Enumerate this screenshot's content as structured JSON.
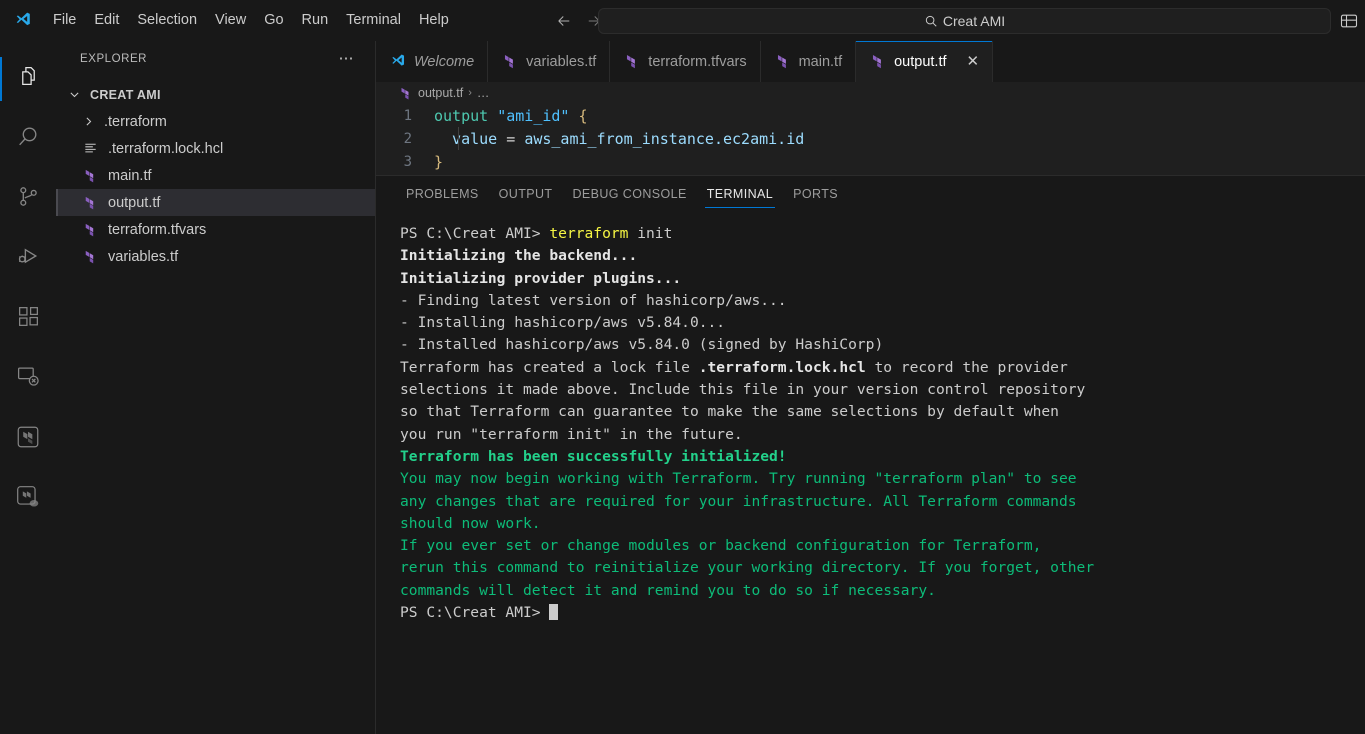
{
  "titlebar": {
    "logo_icon": "vscode-logo-icon",
    "menus": [
      "File",
      "Edit",
      "Selection",
      "View",
      "Go",
      "Run",
      "Terminal",
      "Help"
    ],
    "back_icon": "arrow-left-icon",
    "forward_icon": "arrow-right-icon",
    "command_center": {
      "search_icon": "search-icon",
      "text": "Creat AMI"
    },
    "layout_icon": "customize-layout-icon"
  },
  "activitybar": {
    "items": [
      {
        "name": "explorer",
        "icon": "files-icon",
        "active": true
      },
      {
        "name": "search",
        "icon": "search-icon",
        "active": false
      },
      {
        "name": "source-control",
        "icon": "source-control-icon",
        "active": false
      },
      {
        "name": "run-and-debug",
        "icon": "run-debug-icon",
        "active": false
      },
      {
        "name": "extensions",
        "icon": "extensions-icon",
        "active": false
      },
      {
        "name": "remote-explorer",
        "icon": "remote-explorer-icon",
        "active": false
      },
      {
        "name": "terraform",
        "icon": "terraform-icon",
        "active": false
      },
      {
        "name": "terraform-cloud",
        "icon": "terraform-cloud-icon",
        "active": false
      }
    ]
  },
  "sidebar": {
    "title": "EXPLORER",
    "more_actions_label": "⋯",
    "root": {
      "label": "CREAT AMI",
      "expanded": true,
      "chevron_icon": "chevron-down-icon"
    },
    "items": [
      {
        "label": ".terraform",
        "icon": "chevron-right-icon",
        "kind": "folder",
        "selected": false
      },
      {
        "label": ".terraform.lock.hcl",
        "icon": "hcl-file-icon",
        "kind": "file",
        "selected": false
      },
      {
        "label": "main.tf",
        "icon": "terraform-file-icon",
        "kind": "file",
        "selected": false
      },
      {
        "label": "output.tf",
        "icon": "terraform-file-icon",
        "kind": "file",
        "selected": true
      },
      {
        "label": "terraform.tfvars",
        "icon": "terraform-file-icon",
        "kind": "file",
        "selected": false
      },
      {
        "label": "variables.tf",
        "icon": "terraform-file-icon",
        "kind": "file",
        "selected": false
      }
    ]
  },
  "editor": {
    "tabs": [
      {
        "label": "Welcome",
        "icon": "vscode-logo-icon",
        "active": false,
        "closable": false,
        "italic": true
      },
      {
        "label": "variables.tf",
        "icon": "terraform-file-icon",
        "active": false,
        "closable": false,
        "italic": false
      },
      {
        "label": "terraform.tfvars",
        "icon": "terraform-file-icon",
        "active": false,
        "closable": false,
        "italic": false
      },
      {
        "label": "main.tf",
        "icon": "terraform-file-icon",
        "active": false,
        "closable": false,
        "italic": false
      },
      {
        "label": "output.tf",
        "icon": "terraform-file-icon",
        "active": true,
        "closable": true,
        "italic": false
      }
    ],
    "close_label": "✕",
    "breadcrumb": {
      "file_icon": "terraform-file-icon",
      "file": "output.tf",
      "separator": "›",
      "symbol": "…"
    },
    "code": {
      "lines": [
        {
          "num": "1",
          "tokens": [
            {
              "t": "output",
              "c": "kw"
            },
            {
              "t": " ",
              "c": "plain"
            },
            {
              "t": "\"ami_id\"",
              "c": "str"
            },
            {
              "t": " ",
              "c": "plain"
            },
            {
              "t": "{",
              "c": "brace"
            }
          ]
        },
        {
          "num": "2",
          "tokens": [
            {
              "t": "  value ",
              "c": "ident"
            },
            {
              "t": "= ",
              "c": "op"
            },
            {
              "t": "aws_ami_from_instance.ec2ami.id",
              "c": "ident"
            }
          ]
        },
        {
          "num": "3",
          "tokens": [
            {
              "t": "}",
              "c": "brace"
            }
          ]
        }
      ]
    }
  },
  "panel": {
    "tabs": [
      "PROBLEMS",
      "OUTPUT",
      "DEBUG CONSOLE",
      "TERMINAL",
      "PORTS"
    ],
    "active_tab": "TERMINAL",
    "terminal": {
      "lines": [
        {
          "segments": [
            {
              "text": "PS C:\\Creat AMI> ",
              "color": "#cccccc"
            },
            {
              "text": "terraform",
              "color": "#f5f543"
            },
            {
              "text": " init",
              "color": "#cccccc"
            }
          ]
        },
        {
          "segments": [
            {
              "text": "Initializing the backend...",
              "color": "#e5e5e5",
              "bold": true
            }
          ]
        },
        {
          "segments": [
            {
              "text": "Initializing provider plugins...",
              "color": "#e5e5e5",
              "bold": true
            }
          ]
        },
        {
          "segments": [
            {
              "text": "- Finding latest version of hashicorp/aws...",
              "color": "#cccccc"
            }
          ]
        },
        {
          "segments": [
            {
              "text": "- Installing hashicorp/aws v5.84.0...",
              "color": "#cccccc"
            }
          ]
        },
        {
          "segments": [
            {
              "text": "- Installed hashicorp/aws v5.84.0 (signed by HashiCorp)",
              "color": "#cccccc"
            }
          ]
        },
        {
          "segments": [
            {
              "text": "Terraform has created a lock file ",
              "color": "#cccccc"
            },
            {
              "text": ".terraform.lock.hcl",
              "color": "#e5e5e5",
              "bold": true
            },
            {
              "text": " to record the provider",
              "color": "#cccccc"
            }
          ]
        },
        {
          "segments": [
            {
              "text": "selections it made above. Include this file in your version control repository",
              "color": "#cccccc"
            }
          ]
        },
        {
          "segments": [
            {
              "text": "so that Terraform can guarantee to make the same selections by default when",
              "color": "#cccccc"
            }
          ]
        },
        {
          "segments": [
            {
              "text": "you run \"terraform init\" in the future.",
              "color": "#cccccc"
            }
          ]
        },
        {
          "segments": [
            {
              "text": "",
              "color": "#cccccc"
            }
          ]
        },
        {
          "segments": [
            {
              "text": "Terraform has been successfully initialized!",
              "color": "#23d18b",
              "bold": true
            }
          ]
        },
        {
          "segments": [
            {
              "text": "",
              "color": "#cccccc"
            }
          ]
        },
        {
          "segments": [
            {
              "text": "You may now begin working with Terraform. Try running \"terraform plan\" to see",
              "color": "#0dbc79"
            }
          ]
        },
        {
          "segments": [
            {
              "text": "any changes that are required for your infrastructure. All Terraform commands",
              "color": "#0dbc79"
            }
          ]
        },
        {
          "segments": [
            {
              "text": "should now work.",
              "color": "#0dbc79"
            }
          ]
        },
        {
          "segments": [
            {
              "text": "",
              "color": "#cccccc"
            }
          ]
        },
        {
          "segments": [
            {
              "text": "If you ever set or change modules or backend configuration for Terraform,",
              "color": "#0dbc79"
            }
          ]
        },
        {
          "segments": [
            {
              "text": "rerun this command to reinitialize your working directory. If you forget, other",
              "color": "#0dbc79"
            }
          ]
        },
        {
          "segments": [
            {
              "text": "commands will detect it and remind you to do so if necessary.",
              "color": "#0dbc79"
            }
          ]
        },
        {
          "segments": [
            {
              "text": "PS C:\\Creat AMI> ",
              "color": "#cccccc"
            },
            {
              "text": "",
              "cursor": true
            }
          ]
        }
      ]
    }
  },
  "colors": {
    "accent": "#0078d4",
    "titlebar_bg": "#181818",
    "editor_bg": "#1f1f1f",
    "sidebar_bg": "#181818",
    "terminal_green": "#0dbc79",
    "terminal_bright_green": "#23d18b",
    "terminal_yellow": "#f5f543",
    "terraform_purple": "#a476d4"
  }
}
